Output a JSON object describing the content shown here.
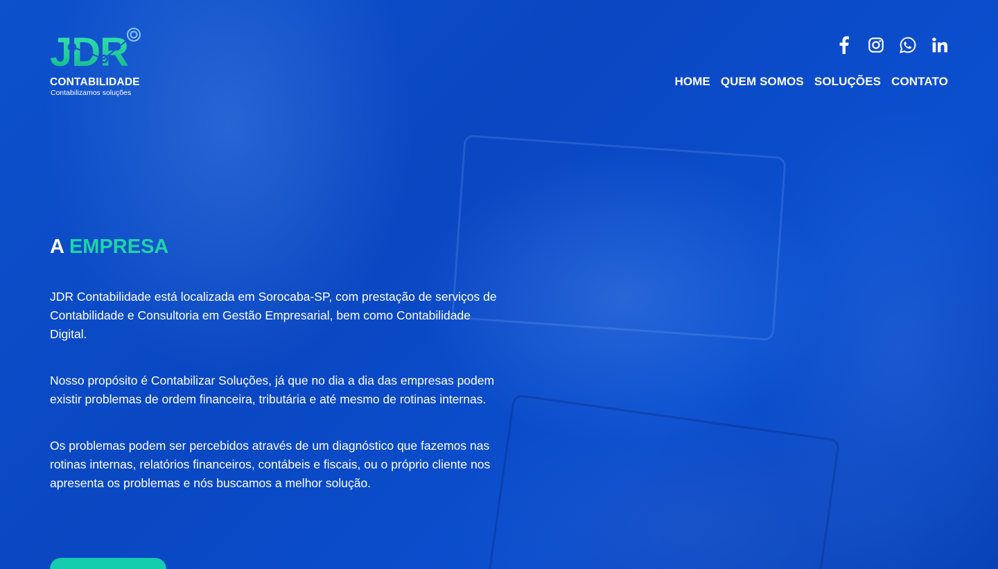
{
  "brand": {
    "logo_text": "JDR",
    "name": "CONTABILIDADE",
    "tagline": "Contabilizamos soluções"
  },
  "social": [
    {
      "icon": "facebook-icon"
    },
    {
      "icon": "instagram-icon"
    },
    {
      "icon": "whatsapp-icon"
    },
    {
      "icon": "linkedin-icon"
    }
  ],
  "nav": {
    "items": [
      "HOME",
      "QUEM SOMOS",
      "SOLUÇÕES",
      "CONTATO"
    ]
  },
  "section": {
    "heading_prefix": "A",
    "heading_accent": "EMPRESA",
    "paragraphs": [
      "JDR Contabilidade está localizada em Sorocaba-SP, com prestação de serviços de Contabilidade e Consultoria em Gestão Empresarial, bem como Contabilidade Digital.",
      "Nosso propósito é Contabilizar Soluções, já que no dia a dia das empresas podem existir problemas de ordem financeira, tributária e até mesmo de rotinas internas.",
      "Os problemas podem ser percebidos através de um diagnóstico que fazemos nas rotinas internas, relatórios financeiros, contábeis e fiscais, ou o próprio cliente nos apresenta os problemas e nós buscamos a melhor solução."
    ]
  },
  "colors": {
    "background": "#0a48c4",
    "accent": "#20d3a6",
    "button": "#14ccae",
    "text": "#ffffff"
  }
}
